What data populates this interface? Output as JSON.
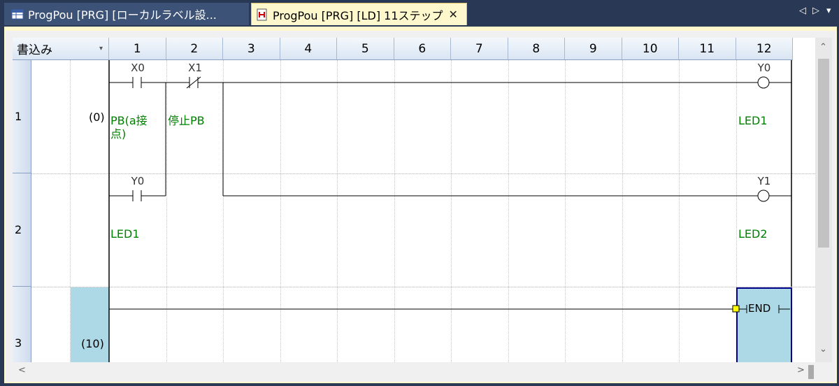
{
  "tabs": [
    {
      "label": "ProgPou [PRG] [ローカルラベル設...",
      "active": false
    },
    {
      "label": "ProgPou [PRG] [LD] 11ステップ",
      "active": true
    }
  ],
  "tab_close": "✕",
  "tab_nav": {
    "left": "◁",
    "right": "▷",
    "menu": "▾"
  },
  "header": {
    "mode": "書込み",
    "mode_arrow": "▾",
    "columns": [
      "1",
      "2",
      "3",
      "4",
      "5",
      "6",
      "7",
      "8",
      "9",
      "10",
      "11",
      "12"
    ]
  },
  "rows": [
    {
      "num": "1",
      "step": "(0)"
    },
    {
      "num": "2",
      "step": ""
    },
    {
      "num": "3",
      "step": "(10)"
    }
  ],
  "elements": {
    "x0": {
      "device": "X0",
      "comment_line1": "PB(a接",
      "comment_line2": "点)"
    },
    "x1": {
      "device": "X1",
      "comment": "停止PB"
    },
    "y0_coil": {
      "device": "Y0",
      "comment": "LED1"
    },
    "y0_contact": {
      "device": "Y0",
      "comment": "LED1"
    },
    "y1_coil": {
      "device": "Y1",
      "comment": "LED2"
    },
    "end": {
      "label": "END"
    }
  },
  "colors": {
    "comment": "#008000",
    "selection": "#add8e6",
    "active_tab": "#fff8cc",
    "frame": "#293955"
  },
  "scroll": {
    "up": "⌃",
    "down": "⌄",
    "left": "<",
    "right": ">"
  }
}
